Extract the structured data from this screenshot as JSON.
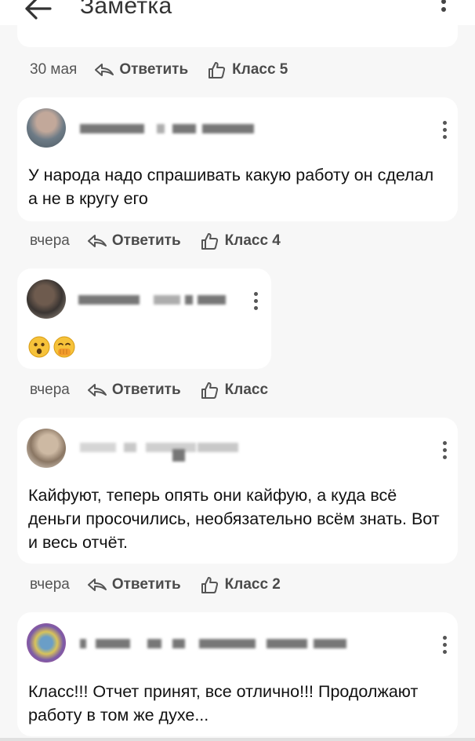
{
  "header": {
    "title": "Заметка"
  },
  "comments": [
    {
      "date": "30 мая",
      "reply": "Ответить",
      "like": "Класс 5"
    },
    {
      "text": "У народа надо спрашивать какую работу он сделал а не в кругу его",
      "date": "вчера",
      "reply": "Ответить",
      "like": "Класс 4"
    },
    {
      "text": "",
      "date": "вчера",
      "reply": "Ответить",
      "like": "Класс"
    },
    {
      "text": "Кайфуют, теперь опять они кайфую, а куда всё деньги просочились, необязательно всём знать. Вот и весь отчёт.",
      "date": "вчера",
      "reply": "Ответить",
      "like": "Класс 2"
    },
    {
      "text": "Класс!!! Отчет принят, все отлично!!! Продолжают работу в том же духе..."
    }
  ],
  "colors": {
    "card_bg": "#ffffff",
    "page_bg": "#f7f7f7",
    "text": "#111111",
    "muted": "#4b4b4b"
  },
  "icons": [
    "back-arrow-icon",
    "kebab-menu-icon",
    "reply-arrow-icon",
    "thumbs-up-icon",
    "astonished-face-emoji",
    "hand-over-mouth-emoji"
  ]
}
